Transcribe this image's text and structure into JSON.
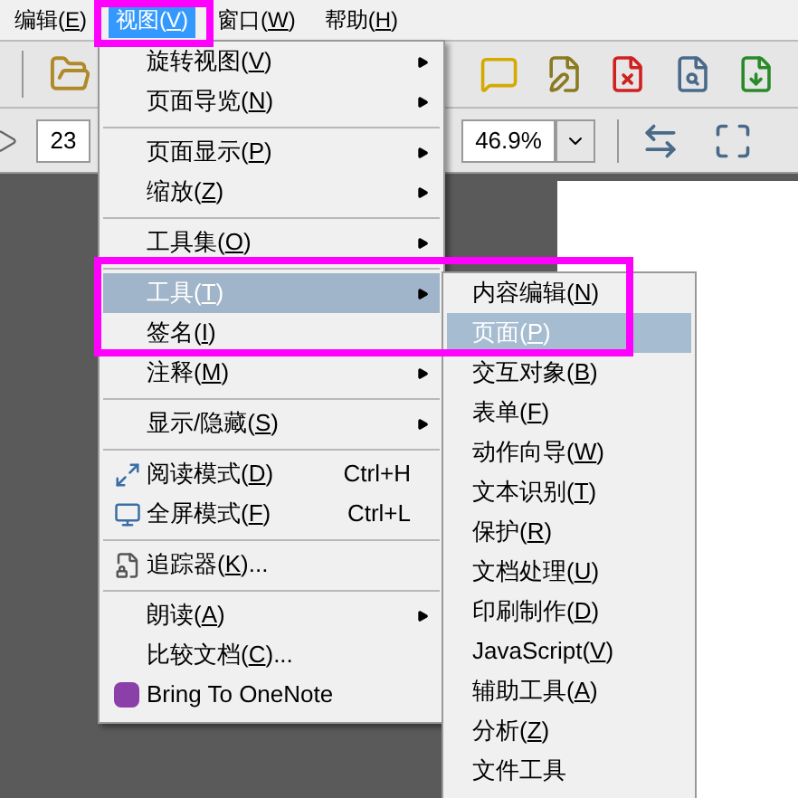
{
  "menubar": [
    {
      "label": "编辑(E)",
      "selected": false
    },
    {
      "label": "视图(V)",
      "selected": true
    },
    {
      "label": "窗口(W)",
      "selected": false
    },
    {
      "label": "帮助(H)",
      "selected": false
    }
  ],
  "toolbar": {
    "page_field": {
      "value": "23"
    },
    "zoom_field": {
      "value": "46.9%"
    }
  },
  "view_menu": [
    {
      "kind": "item",
      "label": "旋转视图(V)",
      "submenu": true,
      "selected": false
    },
    {
      "kind": "item",
      "label": "页面导览(N)",
      "submenu": true,
      "selected": false
    },
    {
      "kind": "separator"
    },
    {
      "kind": "item",
      "label": "页面显示(P)",
      "submenu": true,
      "selected": false
    },
    {
      "kind": "item",
      "label": "缩放(Z)",
      "submenu": true,
      "selected": false
    },
    {
      "kind": "separator"
    },
    {
      "kind": "item",
      "label": "工具集(O)",
      "submenu": true,
      "selected": false
    },
    {
      "kind": "separator"
    },
    {
      "kind": "item",
      "label": "工具(T)",
      "submenu": true,
      "selected": true
    },
    {
      "kind": "item",
      "label": "签名(I)",
      "submenu": false,
      "selected": false
    },
    {
      "kind": "item",
      "label": "注释(M)",
      "submenu": true,
      "selected": false
    },
    {
      "kind": "separator"
    },
    {
      "kind": "item",
      "label": "显示/隐藏(S)",
      "submenu": true,
      "selected": false
    },
    {
      "kind": "separator"
    },
    {
      "kind": "item",
      "label": "阅读模式(D)",
      "shortcut": "Ctrl+H",
      "submenu": false,
      "selected": false
    },
    {
      "kind": "item",
      "label": "全屏模式(F)",
      "shortcut": "Ctrl+L",
      "submenu": false,
      "selected": false
    },
    {
      "kind": "separator"
    },
    {
      "kind": "item",
      "label": "追踪器(K)...",
      "submenu": false,
      "selected": false
    },
    {
      "kind": "separator"
    },
    {
      "kind": "item",
      "label": "朗读(A)",
      "submenu": true,
      "selected": false
    },
    {
      "kind": "item",
      "label": "比较文档(C)...",
      "submenu": false,
      "selected": false
    },
    {
      "kind": "item",
      "label": "Bring To OneNote",
      "submenu": false,
      "selected": false
    }
  ],
  "tools_submenu": [
    {
      "label": "内容编辑(N)",
      "selected": false
    },
    {
      "label": "页面(P)",
      "selected": true
    },
    {
      "label": "交互对象(B)",
      "selected": false
    },
    {
      "label": "表单(F)",
      "selected": false
    },
    {
      "label": "动作向导(W)",
      "selected": false
    },
    {
      "label": "文本识别(T)",
      "selected": false
    },
    {
      "label": "保护(R)",
      "selected": false
    },
    {
      "label": "文档处理(U)",
      "selected": false
    },
    {
      "label": "印刷制作(D)",
      "selected": false
    },
    {
      "label": "JavaScript(V)",
      "selected": false
    },
    {
      "label": "辅助工具(A)",
      "selected": false
    },
    {
      "label": "分析(Z)",
      "selected": false
    },
    {
      "label": "文件工具",
      "selected": false
    }
  ]
}
